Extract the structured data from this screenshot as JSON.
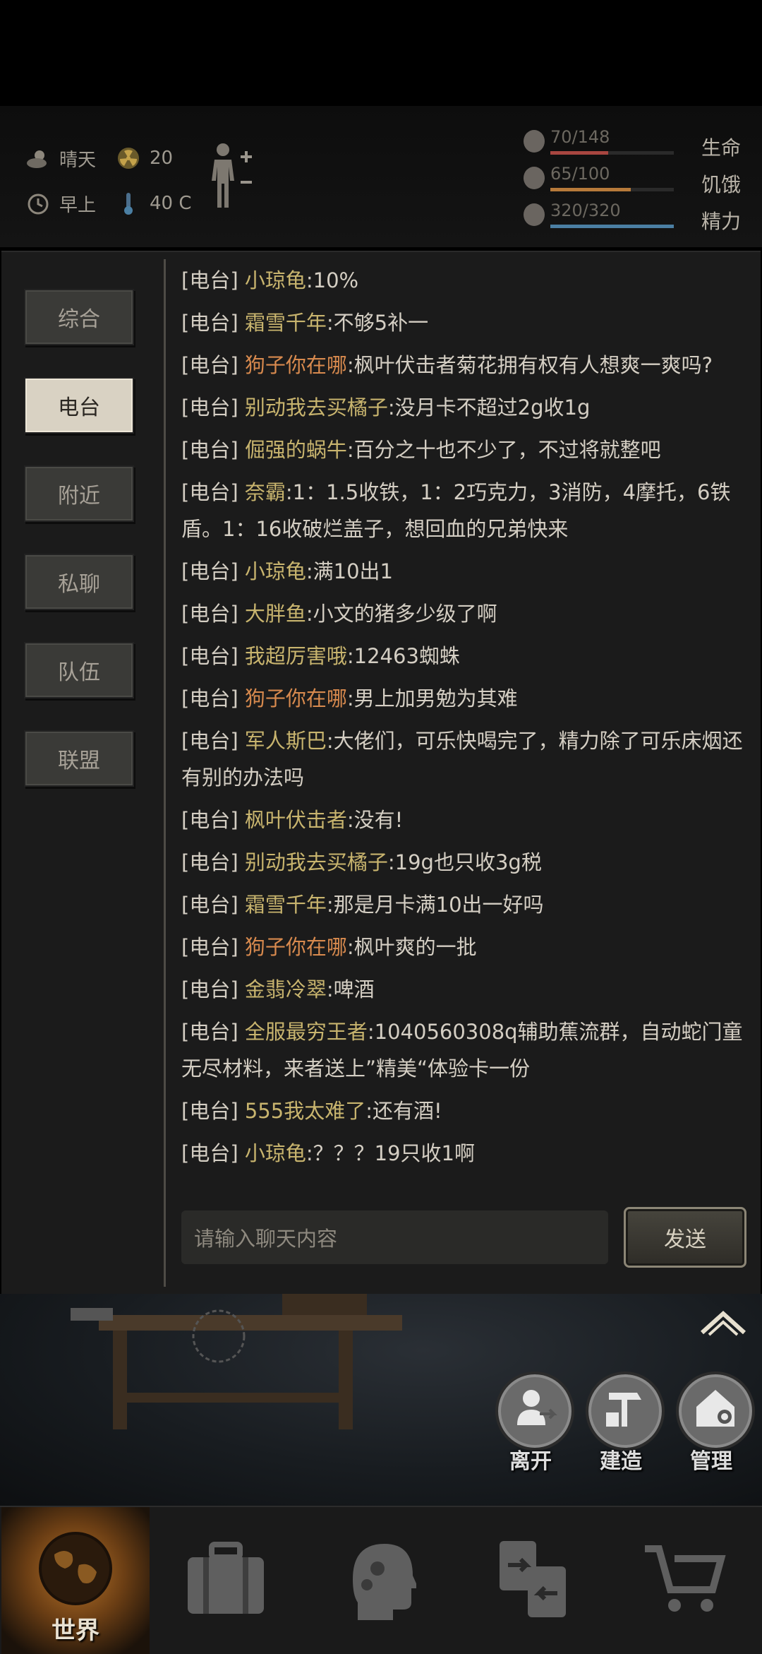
{
  "status": {
    "weather": "晴天",
    "radiation": "20",
    "time_of_day": "早上",
    "temperature": "40 C",
    "bars": [
      {
        "value": "70/148",
        "label": "生命",
        "fill": 0.47,
        "color": "#a84640",
        "icon": "heart-icon"
      },
      {
        "value": "65/100",
        "label": "饥饿",
        "fill": 0.65,
        "color": "#b77a3a",
        "icon": "stomach-icon"
      },
      {
        "value": "320/320",
        "label": "精力",
        "fill": 1.0,
        "color": "#4b7fa3",
        "icon": "brain-icon"
      }
    ]
  },
  "tabs": [
    {
      "label": "综合",
      "active": false
    },
    {
      "label": "电台",
      "active": true
    },
    {
      "label": "附近",
      "active": false
    },
    {
      "label": "私聊",
      "active": false
    },
    {
      "label": "队伍",
      "active": false
    },
    {
      "label": "联盟",
      "active": false
    }
  ],
  "messages": [
    {
      "channel": "[电台]",
      "name": "小琼龟",
      "text": ":10%",
      "color": "gold"
    },
    {
      "channel": "[电台]",
      "name": "霜雪千年",
      "text": ":不够5补一",
      "color": "gold"
    },
    {
      "channel": "[电台]",
      "name": "狗子你在哪",
      "text": ":枫叶伏击者菊花拥有权有人想爽一爽吗?",
      "color": "orange"
    },
    {
      "channel": "[电台]",
      "name": "别动我去买橘子",
      "text": ":没月卡不超过2g收1g",
      "color": "gold"
    },
    {
      "channel": "[电台]",
      "name": "倔强的蜗牛",
      "text": ":百分之十也不少了，不过将就整吧",
      "color": "gold"
    },
    {
      "channel": "[电台]",
      "name": "奈霸",
      "text": ":1：1.5收铁，1：2巧克力，3消防，4摩托，6铁盾。1：16收破烂盖子，想回血的兄弟快来",
      "color": "gold"
    },
    {
      "channel": "[电台]",
      "name": "小琼龟",
      "text": ":满10出1",
      "color": "gold"
    },
    {
      "channel": "[电台]",
      "name": "大胖鱼",
      "text": ":小文的猪多少级了啊",
      "color": "gold"
    },
    {
      "channel": "[电台]",
      "name": "我超厉害哦",
      "text": ":12463蜘蛛",
      "color": "gold"
    },
    {
      "channel": "[电台]",
      "name": "狗子你在哪",
      "text": ":男上加男勉为其难",
      "color": "orange"
    },
    {
      "channel": "[电台]",
      "name": "军人斯巴",
      "text": ":大佬们，可乐快喝完了，精力除了可乐床烟还有别的办法吗",
      "color": "gold"
    },
    {
      "channel": "[电台]",
      "name": "枫叶伏击者",
      "text": ":没有!",
      "color": "gold"
    },
    {
      "channel": "[电台]",
      "name": "别动我去买橘子",
      "text": ":19g也只收3g税",
      "color": "gold"
    },
    {
      "channel": "[电台]",
      "name": "霜雪千年",
      "text": ":那是月卡满10出一好吗",
      "color": "gold"
    },
    {
      "channel": "[电台]",
      "name": "狗子你在哪",
      "text": ":枫叶爽的一批",
      "color": "orange"
    },
    {
      "channel": "[电台]",
      "name": "金翡冷翠",
      "text": ":啤酒",
      "color": "gold"
    },
    {
      "channel": "[电台]",
      "name": "全服最穷王者",
      "text": ":1040560308q辅助蕉流群，自动蛇门童无尽材料，来者送上”精美“体验卡一份",
      "color": "gold"
    },
    {
      "channel": "[电台]",
      "name": "555我太难了",
      "text": ":还有酒!",
      "color": "gold"
    },
    {
      "channel": "[电台]",
      "name": "小琼龟",
      "text": ":？？？19只收1啊",
      "color": "gold"
    }
  ],
  "input": {
    "placeholder": "请输入聊天内容",
    "send_label": "发送"
  },
  "actions": [
    {
      "label": "离开",
      "icon": "leave-icon"
    },
    {
      "label": "建造",
      "icon": "build-icon"
    },
    {
      "label": "管理",
      "icon": "manage-icon"
    }
  ],
  "nav": [
    {
      "label": "世界",
      "icon": "globe-icon",
      "active": true
    },
    {
      "label": "",
      "icon": "suitcase-icon",
      "active": false
    },
    {
      "label": "",
      "icon": "head-gears-icon",
      "active": false
    },
    {
      "label": "",
      "icon": "exchange-icon",
      "active": false
    },
    {
      "label": "",
      "icon": "cart-icon",
      "active": false
    }
  ]
}
